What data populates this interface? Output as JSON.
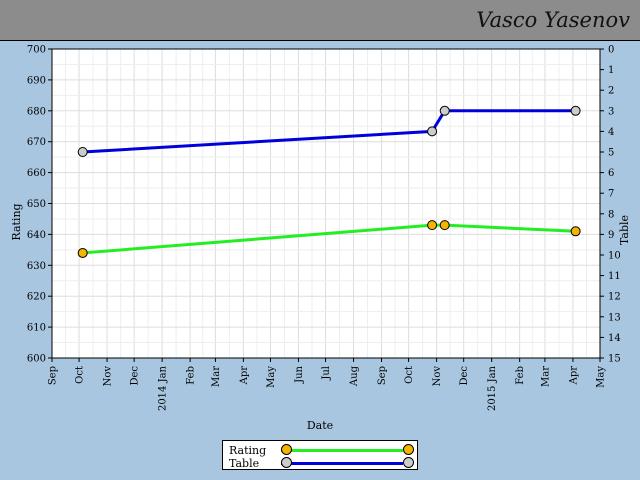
{
  "header": {
    "player_name": "Vasco Yasenov"
  },
  "chart_data": {
    "type": "line",
    "xlabel": "Date",
    "ylabel": "Rating",
    "y2label": "Table",
    "ylim": [
      600,
      700
    ],
    "y2lim": [
      15,
      0
    ],
    "yticks": [
      600,
      610,
      620,
      630,
      640,
      650,
      660,
      670,
      680,
      690,
      700
    ],
    "y2ticks": [
      0,
      1,
      2,
      3,
      4,
      5,
      6,
      7,
      8,
      9,
      10,
      11,
      12,
      13,
      14,
      15
    ],
    "xlim": [
      "2013-09-01",
      "2015-05-01"
    ],
    "xticks": [
      {
        "date": "2013-09-01",
        "label": "Sep"
      },
      {
        "date": "2013-10-01",
        "label": "Oct"
      },
      {
        "date": "2013-11-01",
        "label": "Nov"
      },
      {
        "date": "2013-12-01",
        "label": "Dec"
      },
      {
        "date": "2014-01-01",
        "label": "2014 Jan"
      },
      {
        "date": "2014-02-01",
        "label": "Feb"
      },
      {
        "date": "2014-03-01",
        "label": "Mar"
      },
      {
        "date": "2014-04-01",
        "label": "Apr"
      },
      {
        "date": "2014-05-01",
        "label": "May"
      },
      {
        "date": "2014-06-01",
        "label": "Jun"
      },
      {
        "date": "2014-07-01",
        "label": "Jul"
      },
      {
        "date": "2014-08-01",
        "label": "Aug"
      },
      {
        "date": "2014-09-01",
        "label": "Sep"
      },
      {
        "date": "2014-10-01",
        "label": "Oct"
      },
      {
        "date": "2014-11-01",
        "label": "Nov"
      },
      {
        "date": "2014-12-01",
        "label": "Dec"
      },
      {
        "date": "2015-01-01",
        "label": "2015 Jan"
      },
      {
        "date": "2015-02-01",
        "label": "Feb"
      },
      {
        "date": "2015-03-01",
        "label": "Mar"
      },
      {
        "date": "2015-04-01",
        "label": "Apr"
      },
      {
        "date": "2015-05-01",
        "label": "May"
      }
    ],
    "grid": true,
    "legend_position": "bottom-center",
    "series": [
      {
        "name": "Rating",
        "axis": "left",
        "color": "#22ee22",
        "marker_color": "#f5b400",
        "points": [
          {
            "date": "2013-10-05",
            "value": 634
          },
          {
            "date": "2014-10-27",
            "value": 643
          },
          {
            "date": "2014-11-10",
            "value": 643
          },
          {
            "date": "2015-04-04",
            "value": 641
          }
        ]
      },
      {
        "name": "Table",
        "axis": "right",
        "color": "#0000dd",
        "marker_color": "#cccccc",
        "points": [
          {
            "date": "2013-10-05",
            "value": 5
          },
          {
            "date": "2014-10-27",
            "value": 4
          },
          {
            "date": "2014-11-10",
            "value": 3
          },
          {
            "date": "2015-04-04",
            "value": 3
          }
        ]
      }
    ]
  },
  "legend": [
    {
      "label": "Rating",
      "color": "#22ee22",
      "marker_color": "#f5b400"
    },
    {
      "label": "Table",
      "color": "#0000dd",
      "marker_color": "#cccccc"
    }
  ]
}
